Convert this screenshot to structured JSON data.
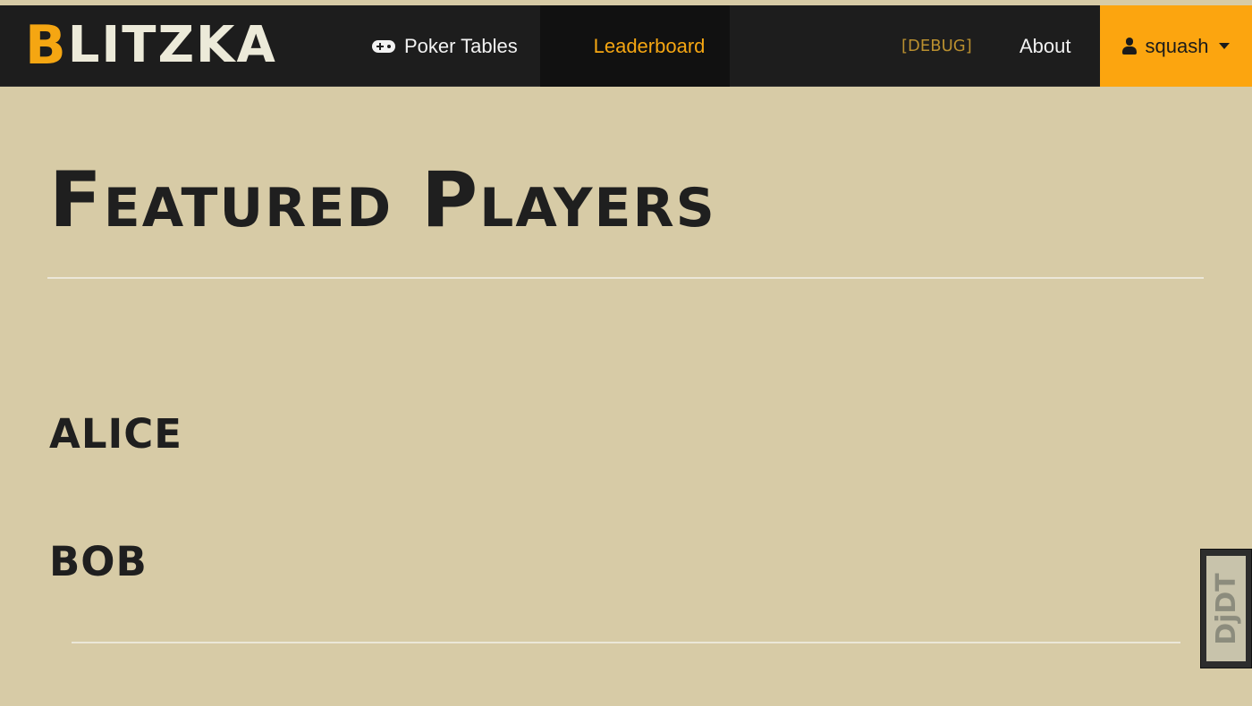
{
  "navbar": {
    "brand_first": "B",
    "brand_rest": "LITZKA",
    "items": [
      {
        "label": "Poker Tables",
        "icon": "gamepad-icon"
      },
      {
        "label": "Leaderboard",
        "icon": "list-ordered-icon"
      },
      {
        "label": "[DEBUG]"
      },
      {
        "label": "About"
      }
    ],
    "user": {
      "label": "squash",
      "icon": "user-icon"
    },
    "colors": {
      "background": "#1d1d1d",
      "accent": "#f5a612",
      "user_bg": "#fca50f"
    }
  },
  "main": {
    "title": "Featured Players",
    "players": [
      "alice",
      "bob"
    ],
    "background": "#d7cba6"
  },
  "djdt": {
    "label": "DjDT"
  }
}
